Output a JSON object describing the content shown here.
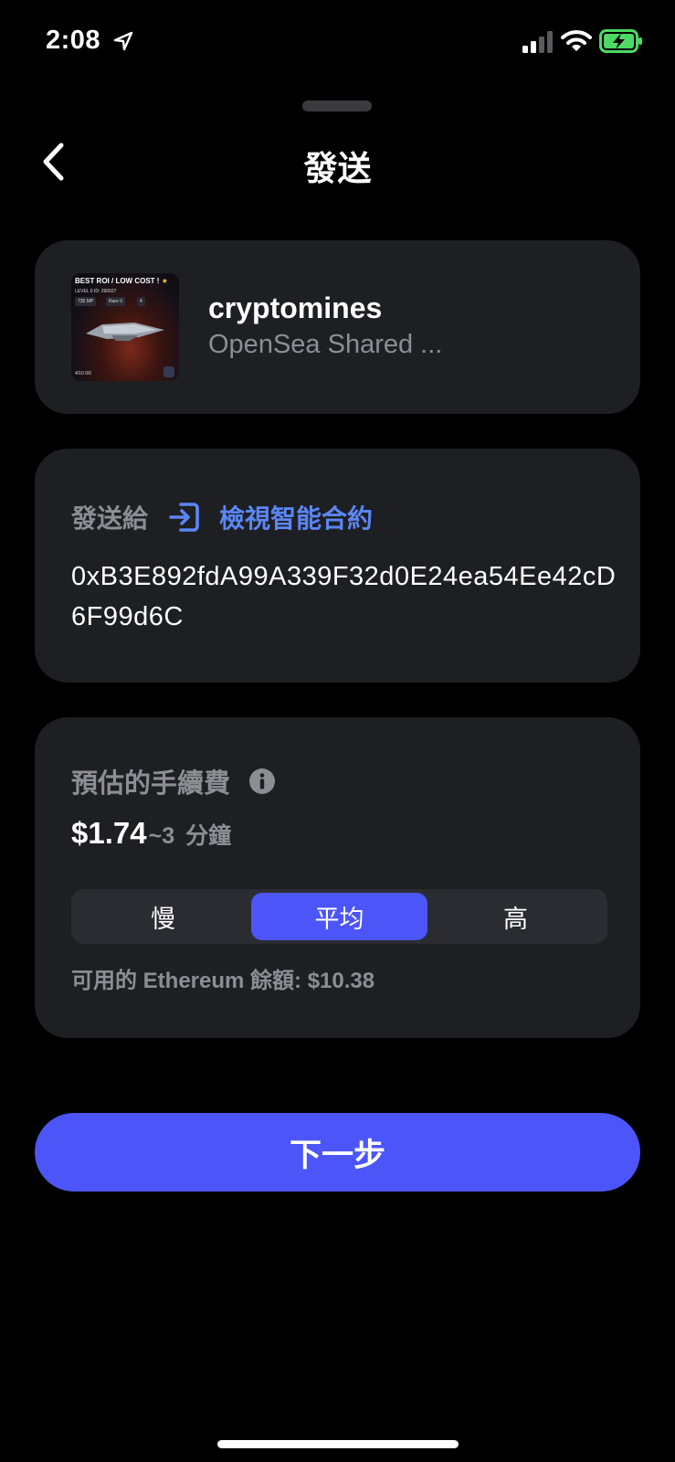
{
  "status_bar": {
    "time": "2:08"
  },
  "header": {
    "title": "發送"
  },
  "nft": {
    "name": "cryptomines",
    "collection": "OpenSea Shared ...",
    "thumbnail": {
      "title": "BEST ROI / LOW COST !",
      "star": "★",
      "subtitle": "LEVEL 0   ID: 290927",
      "chip_1": "735 MP",
      "chip_2": "Rare 0",
      "chip_3": "4",
      "footer": "4/10   0/0"
    }
  },
  "recipient": {
    "label": "發送給",
    "contract_link": "檢視智能合約",
    "address": "0xB3E892fdA99A339F32d0E24ea54Ee42cD6F99d6C"
  },
  "fee": {
    "label": "預估的手續費",
    "amount": "$1.74",
    "time": "~3",
    "time_unit": "分鐘",
    "speed_options": [
      "慢",
      "平均",
      "高"
    ],
    "selected_speed": "平均",
    "balance": "可用的 Ethereum 餘額: $10.38"
  },
  "actions": {
    "next_label": "下一步"
  },
  "colors": {
    "accent": "#4c55f8",
    "link": "#5b86f4",
    "card": "#1e1f23",
    "muted_text": "#8d8e93",
    "battery": "#4cd964"
  }
}
